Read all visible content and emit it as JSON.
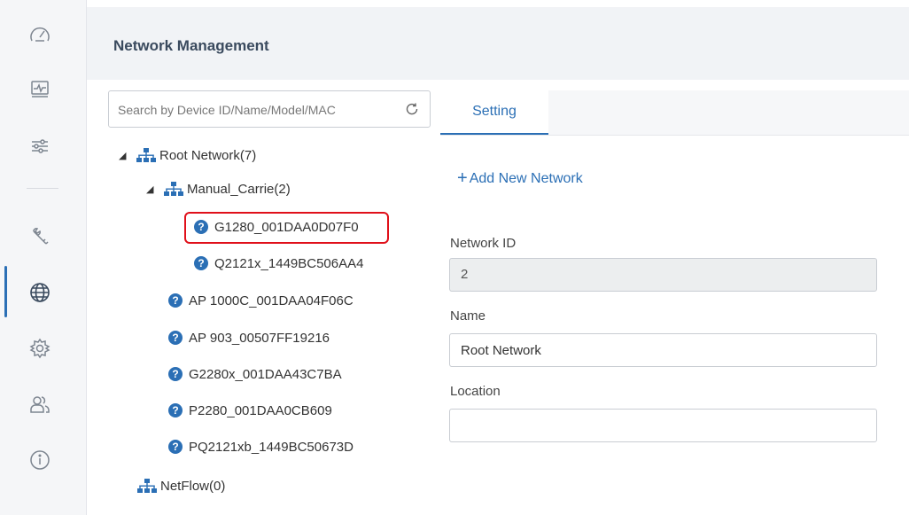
{
  "header": {
    "title": "Network Management"
  },
  "sidebar": {
    "items": [
      {
        "icon": "speedometer-icon",
        "name": "sidebar-item-dashboard"
      },
      {
        "icon": "monitor-icon",
        "name": "sidebar-item-monitor"
      },
      {
        "icon": "sliders-icon",
        "name": "sidebar-item-settings"
      },
      {
        "icon": "wrench-icon",
        "name": "sidebar-item-tools"
      },
      {
        "icon": "globe-icon",
        "name": "sidebar-item-network",
        "active": true
      },
      {
        "icon": "gear-icon",
        "name": "sidebar-item-config"
      },
      {
        "icon": "users-icon",
        "name": "sidebar-item-users"
      },
      {
        "icon": "info-icon",
        "name": "sidebar-item-about"
      }
    ]
  },
  "search": {
    "placeholder": "Search by Device ID/Name/Model/MAC"
  },
  "tree": {
    "root": "Root Network(7)",
    "group": "Manual_Carrie(2)",
    "group_devices": [
      "G1280_001DAA0D07F0",
      "Q2121x_1449BC506AA4"
    ],
    "root_devices": [
      "AP 1000C_001DAA04F06C",
      "AP 903_00507FF19216",
      "G2280x_001DAA43C7BA",
      "P2280_001DAA0CB609",
      "PQ2121xb_1449BC50673D"
    ],
    "netflow": "NetFlow(0)"
  },
  "tabs": {
    "setting": "Setting"
  },
  "form": {
    "add_network": "Add New Network",
    "network_id_label": "Network ID",
    "network_id_value": "2",
    "name_label": "Name",
    "name_value": "Root Network",
    "location_label": "Location",
    "location_value": ""
  },
  "colors": {
    "accent": "#2b6fb5",
    "highlight": "#e0101a"
  }
}
